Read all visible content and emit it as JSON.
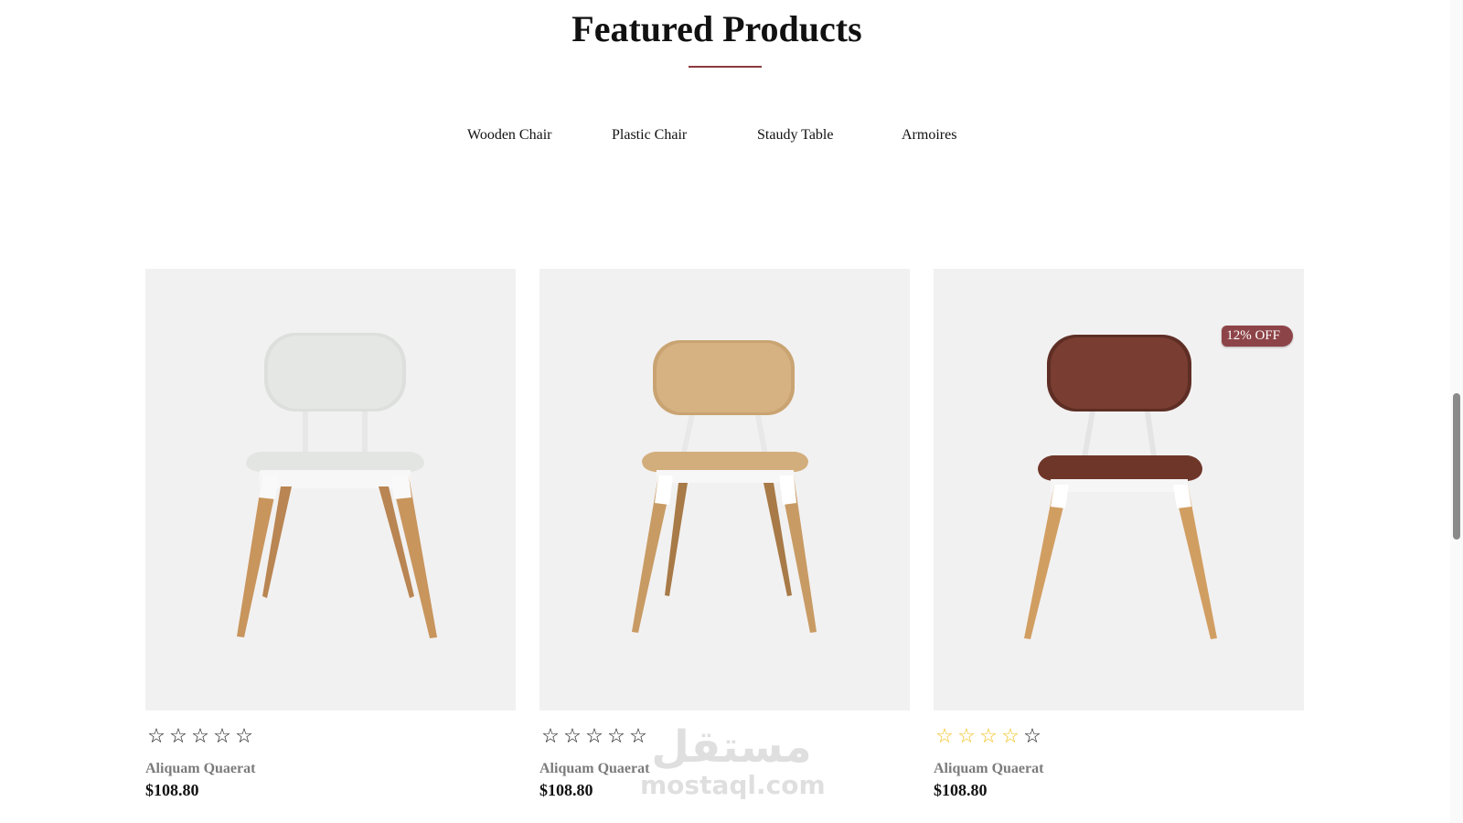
{
  "section": {
    "title": "Featured Products",
    "accent_color": "#8b3a3f"
  },
  "tabs": [
    {
      "label": "Wooden Chair"
    },
    {
      "label": "Plastic Chair"
    },
    {
      "label": "Staudy Table"
    },
    {
      "label": "Armoires"
    }
  ],
  "products": [
    {
      "name": "Aliquam Quaerat",
      "price": "$108.80",
      "image": "white-plastic-chair",
      "rating_stars": 5,
      "stars_gold": 0,
      "badge": ""
    },
    {
      "name": "Aliquam Quaerat",
      "price": "$108.80",
      "image": "wooden-chair",
      "rating_stars": 5,
      "stars_gold": 0,
      "badge": ""
    },
    {
      "name": "Aliquam Quaerat",
      "price": "$108.80",
      "image": "brown-leather-chair",
      "rating_stars": 5,
      "stars_gold": 4,
      "badge": "12% OFF",
      "badge_color": "#8d4448"
    }
  ],
  "watermark": {
    "arabic": "مستقل",
    "latin": "mostaql.com"
  }
}
